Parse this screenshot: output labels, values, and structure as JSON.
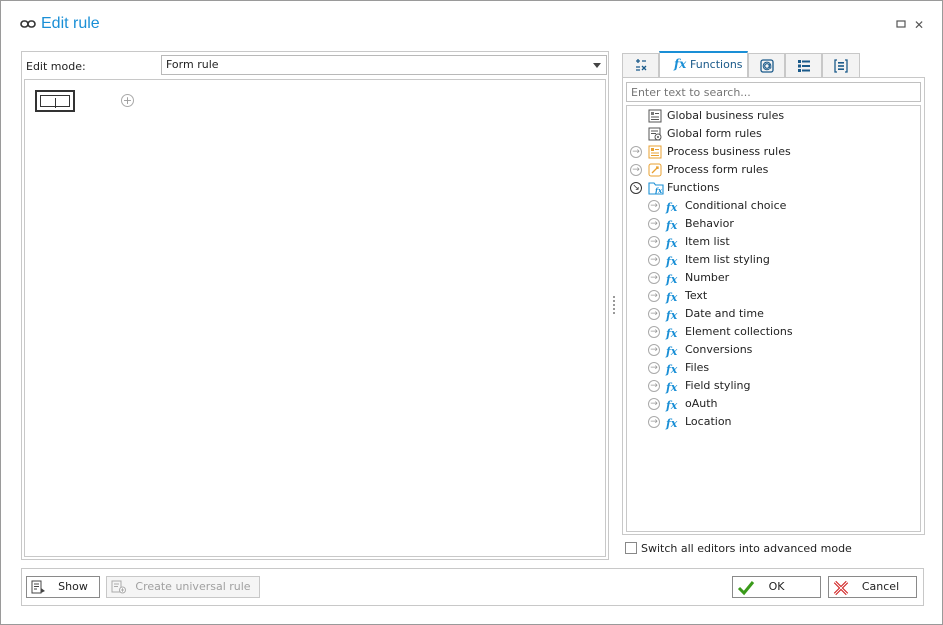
{
  "window": {
    "title": "Edit rule",
    "title_icon": "link-icon",
    "controls": [
      "maximize-icon",
      "close-icon"
    ]
  },
  "editor": {
    "edit_mode_label": "Edit mode:",
    "edit_mode_value": "Form rule"
  },
  "tabs": [
    {
      "name": "operators",
      "icon": "operators-icon",
      "label": ""
    },
    {
      "name": "functions",
      "icon": "fx-icon",
      "label": "Functions",
      "active": true
    },
    {
      "name": "values",
      "icon": "at-icon",
      "label": ""
    },
    {
      "name": "fields",
      "icon": "list-icon",
      "label": ""
    },
    {
      "name": "data",
      "icon": "bracket-list-icon",
      "label": ""
    }
  ],
  "search": {
    "placeholder": "Enter text to search..."
  },
  "tree": {
    "items": [
      {
        "label": "Global business rules",
        "icon": "business-rules-icon",
        "expander": "none",
        "level": 0
      },
      {
        "label": "Global form rules",
        "icon": "form-rules-icon",
        "expander": "none",
        "level": 0
      },
      {
        "label": "Process business rules",
        "icon": "process-business-rules-icon",
        "expander": "closed",
        "level": 0
      },
      {
        "label": "Process form rules",
        "icon": "process-form-rules-icon",
        "expander": "closed",
        "level": 0
      },
      {
        "label": "Functions",
        "icon": "functions-folder-icon",
        "expander": "open",
        "level": 0
      },
      {
        "label": "Conditional choice",
        "icon": "fx-icon",
        "expander": "closed",
        "level": 1
      },
      {
        "label": "Behavior",
        "icon": "fx-icon",
        "expander": "closed",
        "level": 1
      },
      {
        "label": "Item list",
        "icon": "fx-icon",
        "expander": "closed",
        "level": 1
      },
      {
        "label": "Item list styling",
        "icon": "fx-icon",
        "expander": "closed",
        "level": 1
      },
      {
        "label": "Number",
        "icon": "fx-icon",
        "expander": "closed",
        "level": 1
      },
      {
        "label": "Text",
        "icon": "fx-icon",
        "expander": "closed",
        "level": 1
      },
      {
        "label": "Date and time",
        "icon": "fx-icon",
        "expander": "closed",
        "level": 1
      },
      {
        "label": "Element collections",
        "icon": "fx-icon",
        "expander": "closed",
        "level": 1
      },
      {
        "label": "Conversions",
        "icon": "fx-icon",
        "expander": "closed",
        "level": 1
      },
      {
        "label": "Files",
        "icon": "fx-icon",
        "expander": "closed",
        "level": 1
      },
      {
        "label": "Field styling",
        "icon": "fx-icon",
        "expander": "closed",
        "level": 1
      },
      {
        "label": "oAuth",
        "icon": "fx-icon",
        "expander": "closed",
        "level": 1
      },
      {
        "label": "Location",
        "icon": "fx-icon",
        "expander": "closed",
        "level": 1
      }
    ]
  },
  "advanced_mode": {
    "label": "Switch all editors into advanced mode",
    "checked": false
  },
  "footer": {
    "show_label": "Show",
    "create_universal_label": "Create universal rule",
    "ok_label": "OK",
    "cancel_label": "Cancel"
  },
  "colors": {
    "accent": "#1a8fd6",
    "ok_green": "#3a9a1a",
    "cancel_red": "#d02020",
    "orange": "#e8a030"
  }
}
